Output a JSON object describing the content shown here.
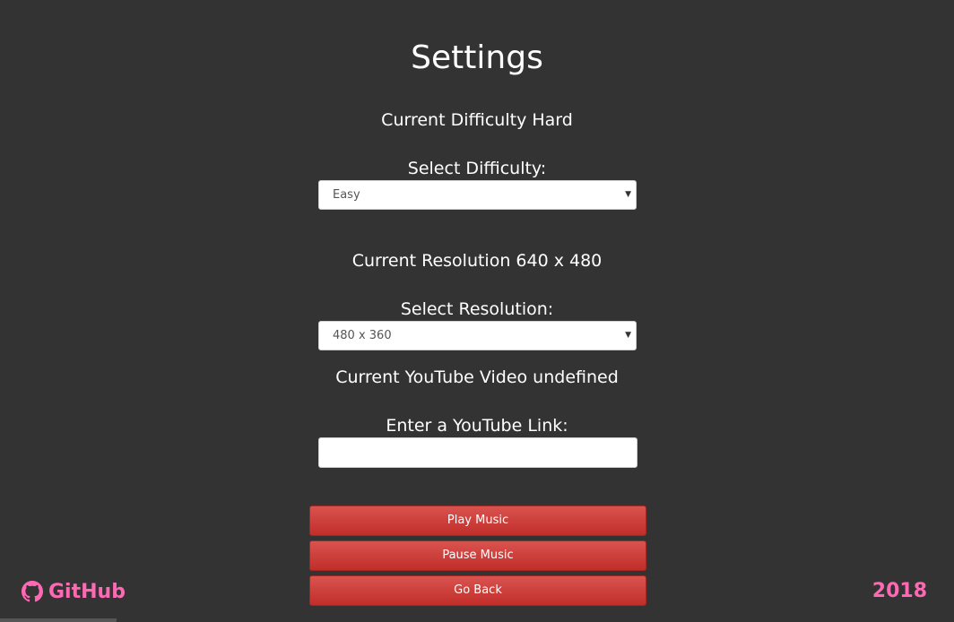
{
  "page": {
    "title": "Settings"
  },
  "difficulty": {
    "current_text": "Current Difficulty Hard",
    "select_label": "Select Difficulty:",
    "selected_value": "Easy"
  },
  "resolution": {
    "current_text": "Current Resolution 640 x 480",
    "select_label": "Select Resolution:",
    "selected_value": "480 x 360"
  },
  "youtube": {
    "current_text": "Current YouTube Video undefined",
    "input_label": "Enter a YouTube Link:",
    "input_value": "",
    "input_placeholder": ""
  },
  "buttons": {
    "play_label": "Play Music",
    "pause_label": "Pause Music",
    "back_label": "Go Back"
  },
  "footer": {
    "github_label": "GitHub",
    "github_icon": "github-icon",
    "year": "2018",
    "accent_color": "#ff69b4"
  },
  "colors": {
    "background": "#333333",
    "button": "#d9534f"
  }
}
